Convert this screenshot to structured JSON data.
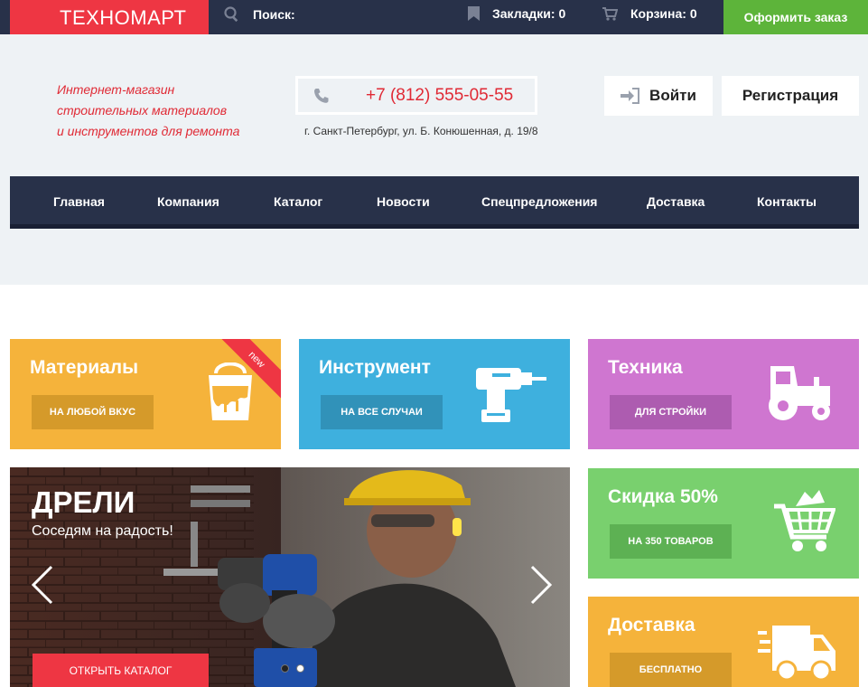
{
  "topbar": {
    "logo": "ТЕХНОМАРТ",
    "search_label": "Поиск:",
    "bookmarks_label": "Закладки: 0",
    "cart_label": "Корзина: 0",
    "order_button": "Оформить заказ"
  },
  "header": {
    "slogan_line1": "Интернет-магазин",
    "slogan_line2": "строительных материалов",
    "slogan_line3": "и инструментов для ремонта",
    "phone": "+7 (812) 555-05-55",
    "address": "г. Санкт-Петербург, ул. Б. Конюшенная, д. 19/8",
    "login_button": "Войти",
    "register_button": "Регистрация"
  },
  "nav": {
    "items": [
      "Главная",
      "Компания",
      "Каталог",
      "Новости",
      "Спецпредложения",
      "Доставка",
      "Контакты"
    ]
  },
  "tiles": {
    "materials": {
      "title": "Материалы",
      "button": "НА ЛЮБОЙ ВКУС",
      "badge": "new",
      "color": "#f5b33b"
    },
    "instruments": {
      "title": "Инструмент",
      "button": "НА ВСЕ СЛУЧАИ",
      "color": "#3eb0de"
    },
    "technics": {
      "title": "Техника",
      "button": "ДЛЯ СТРОЙКИ",
      "color": "#cf76d0"
    },
    "sale": {
      "title": "Скидка 50%",
      "button": "НА 350 ТОВАРОВ",
      "color": "#79d06e"
    },
    "delivery": {
      "title": "Доставка",
      "button": "БЕСПЛАТНО",
      "color": "#f5b33b"
    }
  },
  "slider": {
    "title": "ДРЕЛИ",
    "subtitle": "Соседям на радость!",
    "button": "ОТКРЫТЬ КАТАЛОГ",
    "active_slide": 2,
    "slide_count": 2
  },
  "colors": {
    "brand_red": "#ee3643",
    "dark_navy": "#283149",
    "green": "#5db43a"
  }
}
